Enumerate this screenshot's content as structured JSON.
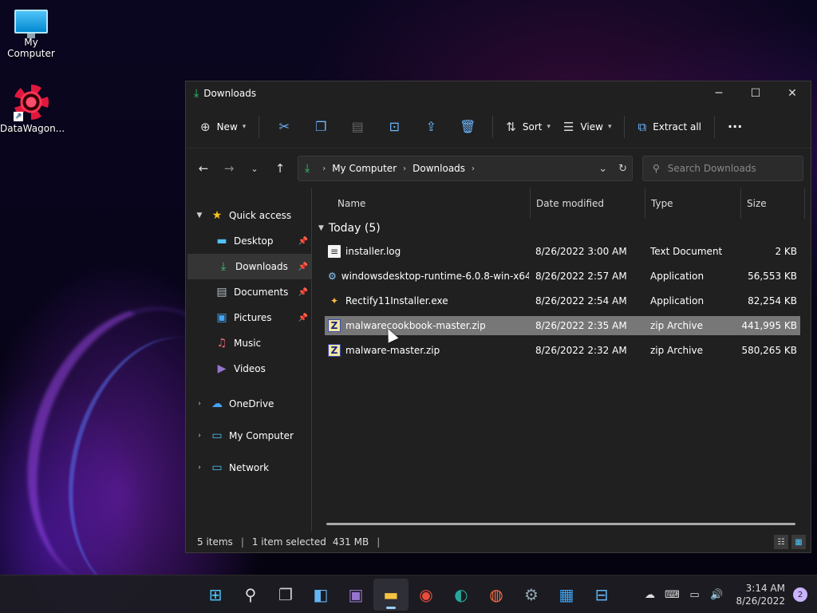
{
  "desktop": {
    "icons": [
      {
        "label": "My Computer",
        "icon": "monitor-icon"
      },
      {
        "label": "DataWagon...",
        "icon": "datawagon-icon"
      }
    ]
  },
  "window": {
    "title": "Downloads",
    "controls": {
      "minimize": "─",
      "maximize": "☐",
      "close": "✕"
    }
  },
  "toolbar": {
    "new_label": "New",
    "sort_label": "Sort",
    "view_label": "View",
    "extract_label": "Extract all",
    "more_label": "···"
  },
  "address": {
    "crumbs": [
      "My Computer",
      "Downloads"
    ],
    "search_placeholder": "Search Downloads"
  },
  "navpane": {
    "quick_access": "Quick access",
    "pinned": [
      "Desktop",
      "Downloads",
      "Documents",
      "Pictures"
    ],
    "unpinned": [
      "Music",
      "Videos"
    ],
    "roots": [
      "OneDrive",
      "My Computer",
      "Network"
    ],
    "selected": "Downloads"
  },
  "columns": {
    "name": "Name",
    "date": "Date modified",
    "type": "Type",
    "size": "Size"
  },
  "group": {
    "label": "Today (5)"
  },
  "files": [
    {
      "name": "installer.log",
      "date": "8/26/2022 3:00 AM",
      "type": "Text Document",
      "size": "2 KB",
      "icon": "text-file-icon"
    },
    {
      "name": "windowsdesktop-runtime-6.0.8-win-x64....",
      "date": "8/26/2022 2:57 AM",
      "type": "Application",
      "size": "56,553 KB",
      "icon": "installer-icon"
    },
    {
      "name": "Rectify11Installer.exe",
      "date": "8/26/2022 2:54 AM",
      "type": "Application",
      "size": "82,254 KB",
      "icon": "app-icon"
    },
    {
      "name": "malwarecookbook-master.zip",
      "date": "8/26/2022 2:35 AM",
      "type": "zip Archive",
      "size": "441,995 KB",
      "icon": "zip-icon"
    },
    {
      "name": "malware-master.zip",
      "date": "8/26/2022 2:32 AM",
      "type": "zip Archive",
      "size": "580,265 KB",
      "icon": "zip-icon"
    }
  ],
  "status": {
    "items": "5 items",
    "selected": "1 item selected",
    "size": "431 MB"
  },
  "taskbar": {
    "time": "3:14 AM",
    "date": "8/26/2022",
    "notifications": "2"
  },
  "colors": {
    "accent": "#6fb7ff",
    "selection": "#777777",
    "window_bg": "#202020"
  }
}
